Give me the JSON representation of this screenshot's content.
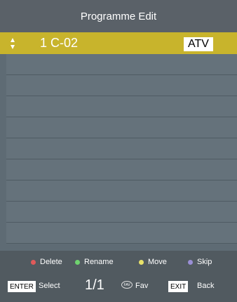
{
  "header": {
    "title": "Programme Edit"
  },
  "selected_row": {
    "number": "1",
    "name": "C-02",
    "type_badge": "ATV"
  },
  "empty_rows": 9,
  "legend": [
    {
      "label": "Delete",
      "color": "#e05a5a"
    },
    {
      "label": "Rename",
      "color": "#6fd36f"
    },
    {
      "label": "Move",
      "color": "#e8e26a"
    },
    {
      "label": "Skip",
      "color": "#9a8fd6"
    }
  ],
  "keys": {
    "enter_key": "ENTER",
    "enter_label": "Select",
    "page": "1/1",
    "fav_key": "FAV",
    "fav_label": "Fav",
    "exit_key": "EXIT",
    "exit_label": "Back"
  }
}
